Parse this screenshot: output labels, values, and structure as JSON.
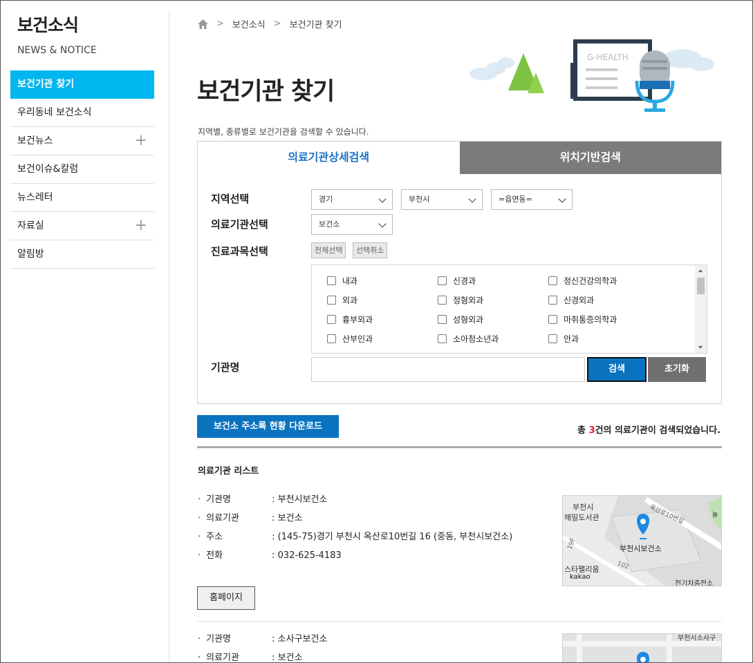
{
  "sidebar": {
    "title": "보건소식",
    "subtitle": "NEWS & NOTICE",
    "items": [
      {
        "label": "보건기관 찾기"
      },
      {
        "label": "우리동네 보건소식"
      },
      {
        "label": "보건뉴스"
      },
      {
        "label": "보건이슈&칼럼"
      },
      {
        "label": "뉴스레터"
      },
      {
        "label": "자료실"
      },
      {
        "label": "알림방"
      }
    ]
  },
  "breadcrumb": [
    "보건소식",
    "보건기관 찾기"
  ],
  "page": {
    "title": "보건기관 찾기",
    "description": "지역별, 종류별로 보건기관을 검색할 수 있습니다.",
    "illustration_text": "G-HEALTH"
  },
  "search": {
    "tabs": [
      "의료기관상세검색",
      "위치기반검색"
    ],
    "labels": {
      "region": "지역선택",
      "institution": "의료기관선택",
      "department": "진료과목선택",
      "name": "기관명"
    },
    "region": {
      "province": "경기",
      "city": "부천시",
      "town": "=읍면동="
    },
    "institution_type": "보건소",
    "select_all": "전체선택",
    "deselect": "선택취소",
    "departments": [
      "내과",
      "신경과",
      "정신건강의학과",
      "외과",
      "정형외과",
      "신경외과",
      "흉부외과",
      "성형외과",
      "마취통증의학과",
      "산부인과",
      "소아청소년과",
      "안과"
    ],
    "name_value": "",
    "search_button": "검색",
    "reset_button": "초기화"
  },
  "download_button": "보건소 주소록 현황 다운로드",
  "result": {
    "prefix": "총 ",
    "count": "3",
    "suffix": "건의 의료기관이 검색되었습니다."
  },
  "list_title": "의료기관 리스트",
  "results": [
    {
      "rows": [
        {
          "key": "기관명",
          "value": ": 부천시보건소"
        },
        {
          "key": "의료기관",
          "value": ": 보건소"
        },
        {
          "key": "주소",
          "value": ": (145-75)경기 부천시 옥산로10번길 16 (중동, 부천시보건소)"
        },
        {
          "key": "전화",
          "value": ": 032-625-4183"
        }
      ],
      "homepage_button": "홈페이지",
      "map_labels": [
        "부천시",
        "해밀도서관",
        "옥산로10번길",
        "부천시보건소",
        "스타팰리움",
        "kakao",
        "전기차충전소",
        "102",
        "19F",
        "놀"
      ]
    },
    {
      "rows": [
        {
          "key": "기관명",
          "value": ": 소사구보건소"
        },
        {
          "key": "의료기관",
          "value": ": 보건소"
        }
      ],
      "map_labels": [
        "부천시소사구"
      ]
    }
  ],
  "colors": {
    "accent": "#00b6ef",
    "primary_button": "#0a73c0",
    "tab_off": "#7b7b7b",
    "count_red": "#e0252b",
    "map_pin": "#1e88e5"
  }
}
